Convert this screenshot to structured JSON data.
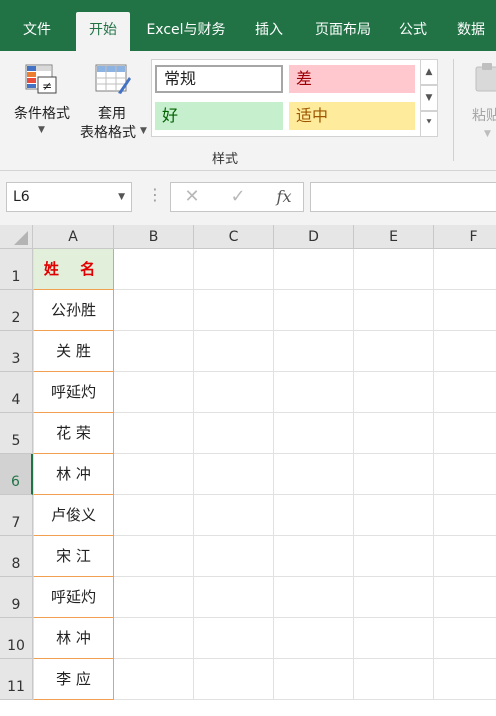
{
  "ribbon_tabs": [
    {
      "label": "文件",
      "active": false
    },
    {
      "label": "开始",
      "active": true
    },
    {
      "label": "Excel与财务",
      "active": false
    },
    {
      "label": "插入",
      "active": false
    },
    {
      "label": "页面布局",
      "active": false
    },
    {
      "label": "公式",
      "active": false
    },
    {
      "label": "数据",
      "active": false
    }
  ],
  "ribbon": {
    "conditional_format_label": "条件格式",
    "table_format_label_1": "套用",
    "table_format_label_2": "表格格式",
    "styles": {
      "normal": "常规",
      "bad": "差",
      "good": "好",
      "neutral": "适中"
    },
    "group_label": "样式",
    "paste_label": "粘贴"
  },
  "formula_bar": {
    "name_box": "L6",
    "cancel_symbol": "✕",
    "confirm_symbol": "✓",
    "fx_symbol": "fx",
    "content": ""
  },
  "sheet": {
    "columns": [
      "A",
      "B",
      "C",
      "D",
      "E",
      "F"
    ],
    "rows": [
      "1",
      "2",
      "3",
      "4",
      "5",
      "6",
      "7",
      "8",
      "9",
      "10",
      "11"
    ],
    "selected_row": "6",
    "column_a": [
      "姓 名",
      "公孙胜",
      "关 胜",
      "呼延灼",
      "花 荣",
      "林 冲",
      "卢俊义",
      "宋 江",
      "呼延灼",
      "林 冲",
      "李 应"
    ]
  },
  "colors": {
    "accent": "#217346",
    "header_fill": "#e2efda",
    "header_text": "#e00000",
    "bad_fill": "#ffc7ce",
    "bad_text": "#9c0006",
    "good_fill": "#c6efce",
    "good_text": "#006100",
    "neutral_fill": "#ffeb9c",
    "neutral_text": "#9c5700"
  }
}
